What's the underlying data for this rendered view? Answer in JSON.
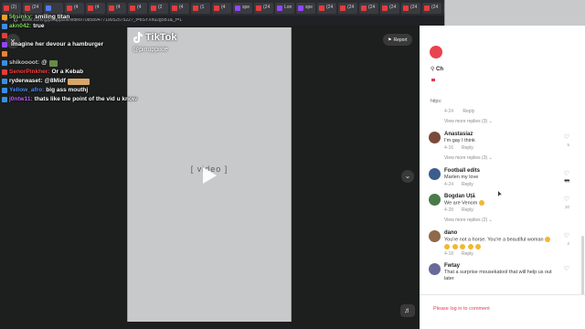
{
  "browser": {
    "tabs": [
      {
        "label": "(2)",
        "color": "#e43c3c"
      },
      {
        "label": "(24",
        "color": "#e43c3c"
      },
      {
        "label": "",
        "color": "#4d7df0"
      },
      {
        "label": "(4",
        "color": "#e43c3c"
      },
      {
        "label": "(4",
        "color": "#e43c3c"
      },
      {
        "label": "(4",
        "color": "#e43c3c"
      },
      {
        "label": "(4",
        "color": "#e43c3c"
      },
      {
        "label": "(2",
        "color": "#e43c3c"
      },
      {
        "label": "(4",
        "color": "#e43c3c"
      },
      {
        "label": "(1",
        "color": "#e43c3c"
      },
      {
        "label": "(4",
        "color": "#e43c3c"
      },
      {
        "label": "spe",
        "color": "#9146ff"
      },
      {
        "label": "(24",
        "color": "#e43c3c"
      },
      {
        "label": "Lon",
        "color": "#9146ff"
      },
      {
        "label": "spe",
        "color": "#9146ff"
      },
      {
        "label": "(24",
        "color": "#e43c3c"
      },
      {
        "label": "(24",
        "color": "#e43c3c"
      },
      {
        "label": "(24",
        "color": "#e43c3c"
      },
      {
        "label": "(24",
        "color": "#e43c3c"
      },
      {
        "label": "(24",
        "color": "#e43c3c"
      },
      {
        "label": "(24",
        "color": "#e43c3c"
      },
      {
        "label": "(24",
        "color": "#e43c3c"
      }
    ],
    "url": "tiktok.com/@pinuppixie/video/7085894771905257522?_t=8SYXnu2g5B1&_r=1"
  },
  "chat": [
    {
      "user": "56sinky:",
      "user_color": "#7ed957",
      "badge": "#f0a020",
      "message": "smiling titan"
    },
    {
      "user": "akn042:",
      "user_color": "#7ed957",
      "badge": "#3a8ee6",
      "message": "true"
    },
    {
      "user": "",
      "user_color": "#ff5a5a",
      "badge": "#e43c3c",
      "message": ""
    },
    {
      "user": "",
      "user_color": "#ff5a5a",
      "badge": "#9146ff",
      "message": "imagine her devour a hamburger"
    },
    {
      "user": "",
      "user_color": "#ff5a5a",
      "badge": "#f08030",
      "message": ""
    },
    {
      "user": "shikoooot:",
      "user_color": "#c8c8c8",
      "badge": "#3a8ee6",
      "message": "@",
      "emote": "small"
    },
    {
      "user": "SenorPinkher:",
      "user_color": "#ff4040",
      "badge": "#e43c3c",
      "message": "Or a Kebab"
    },
    {
      "user": "ryderwaset:",
      "user_color": "#ffffff",
      "badge": "#3a8ee6",
      "message": "@8Midf",
      "emote": "wide"
    },
    {
      "user": "Yellow_afro:",
      "user_color": "#4f8fff",
      "badge": "#3a8ee6",
      "message": "big ass mouthj"
    },
    {
      "user": "j0ntw11:",
      "user_color": "#c060ff",
      "badge": "#3a8ee6",
      "message": "thats like the point of the vid u know"
    }
  ],
  "player": {
    "logo": "TikTok",
    "handle": "@pinuppixie",
    "report_label": "Report"
  },
  "panel": {
    "channel_short": "Ch",
    "url_short": "https:",
    "login_label": "Please log in to comment",
    "first_meta": {
      "time": "4-24",
      "reply": "Reply"
    },
    "first_more": "View more replies (3)",
    "comments": [
      {
        "name": "Anastasiaz",
        "text": "I'm gay I think",
        "time": "4-16",
        "reply": "Reply",
        "likes": "5",
        "more": "View more replies (3)",
        "avatar": "#7a4b3b"
      },
      {
        "name": "Football edits",
        "text": "Marlen my love",
        "time": "4-24",
        "reply": "Reply",
        "likes": "44",
        "more": "",
        "avatar": "#3c5d8c"
      },
      {
        "name": "Bogdan Uță",
        "text": "We are Venom",
        "emoji": 1,
        "time": "4-28",
        "reply": "Reply",
        "likes": "30",
        "more": "View more replies (2)",
        "avatar": "#4a7a4a"
      },
      {
        "name": "dano",
        "text": "You're not a horse. You're a beautiful woman",
        "emoji": 6,
        "time": "4-18",
        "reply": "Reply",
        "likes": "2",
        "more": "",
        "avatar": "#8c6a4a"
      },
      {
        "name": "Fwtay",
        "text": "That a surprise mousekatool that will help us out later",
        "emoji": 0,
        "time": "",
        "reply": "",
        "likes": "",
        "more": "",
        "avatar": "#6a6a9a"
      }
    ]
  },
  "colors": {
    "tiktok_red": "#e33d5a",
    "chat_shadow": "#000000"
  }
}
